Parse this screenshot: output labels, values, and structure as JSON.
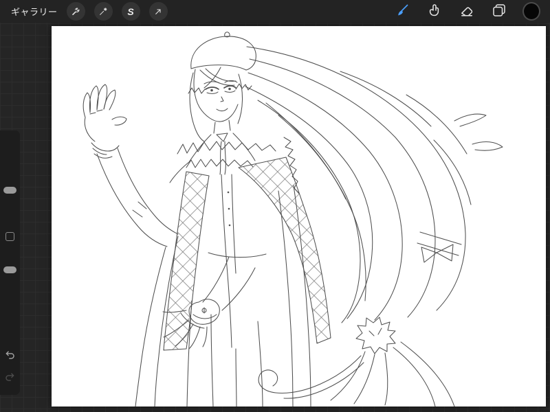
{
  "app": {
    "name": "Procreate"
  },
  "topbar": {
    "gallery_label": "ギャラリー",
    "selection_glyph": "S",
    "left_tools": [
      {
        "name": "actions",
        "icon": "wrench-icon"
      },
      {
        "name": "adjustments",
        "icon": "magic-wand-icon"
      },
      {
        "name": "selection",
        "icon": "selection-s-icon"
      },
      {
        "name": "transform",
        "icon": "move-arrow-icon"
      }
    ],
    "right_tools": [
      {
        "name": "paint",
        "icon": "brush-icon",
        "active": true
      },
      {
        "name": "smudge",
        "icon": "smudge-icon",
        "active": false
      },
      {
        "name": "erase",
        "icon": "eraser-icon",
        "active": false
      },
      {
        "name": "layers",
        "icon": "layers-icon",
        "active": false
      },
      {
        "name": "color",
        "icon": "color-swatch",
        "active": false,
        "value": "#000000"
      }
    ],
    "accent_color": "#4a9df8"
  },
  "sidebar": {
    "controls": [
      {
        "name": "brush-size-slider"
      },
      {
        "name": "modify-button"
      },
      {
        "name": "opacity-slider"
      },
      {
        "name": "undo-button"
      },
      {
        "name": "redo-button"
      }
    ]
  },
  "canvas": {
    "background": "#ffffff",
    "artwork_description": "Monochrome line-art sketch of an anime-style character wearing a beret and a long coat with fur collar and diamond-patterned drapes; one gloved hand raised open beside the head, the other gloved hand extended forward; very long hair flows to the right, gathered by a fluffy tie and ending in long curling strands."
  },
  "colors": {
    "workspace_background": "#252525",
    "grid_line": "#2d2d2d",
    "topbar_background": "#232323",
    "sidebar_background": "#1d1d1d",
    "icon_color": "#e6e6e6",
    "accent": "#4a9df8",
    "canvas": "#ffffff",
    "line_art": "#4f4f4f"
  }
}
